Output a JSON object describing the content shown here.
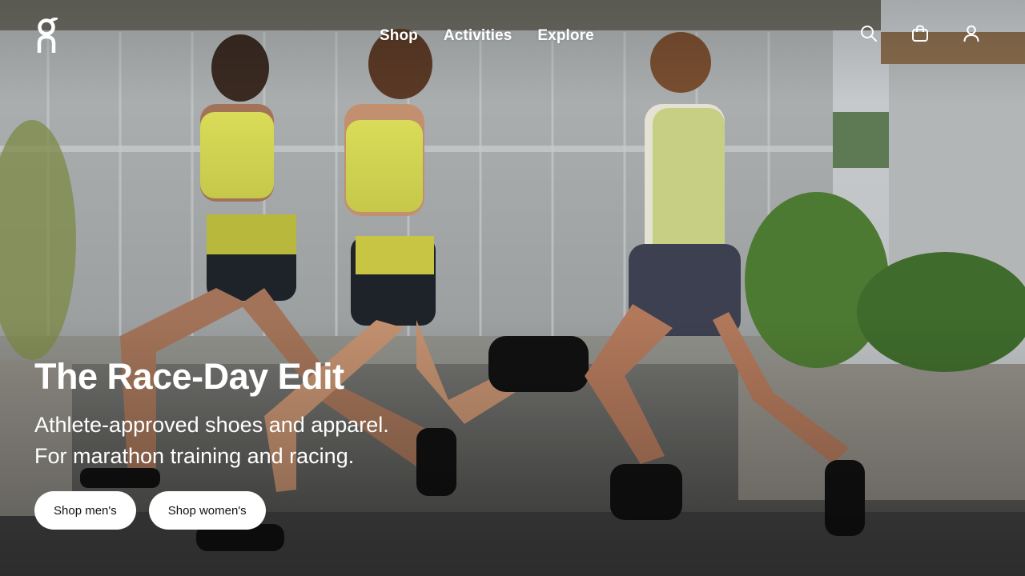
{
  "header": {
    "logo_label": "On",
    "nav": [
      {
        "label": "Shop"
      },
      {
        "label": "Activities"
      },
      {
        "label": "Explore"
      }
    ],
    "icons": [
      "search-icon",
      "shopping-bag-icon",
      "account-icon"
    ]
  },
  "hero": {
    "title": "The Race-Day Edit",
    "subtitle_line1": "Athlete-approved shoes and apparel.",
    "subtitle_line2": "For marathon training and racing.",
    "cta_men": "Shop men's",
    "cta_women": "Shop women's"
  },
  "colors": {
    "text": "#ffffff",
    "button_bg": "#ffffff",
    "button_text": "#111111",
    "apparel_accent": "#d7dd56"
  }
}
